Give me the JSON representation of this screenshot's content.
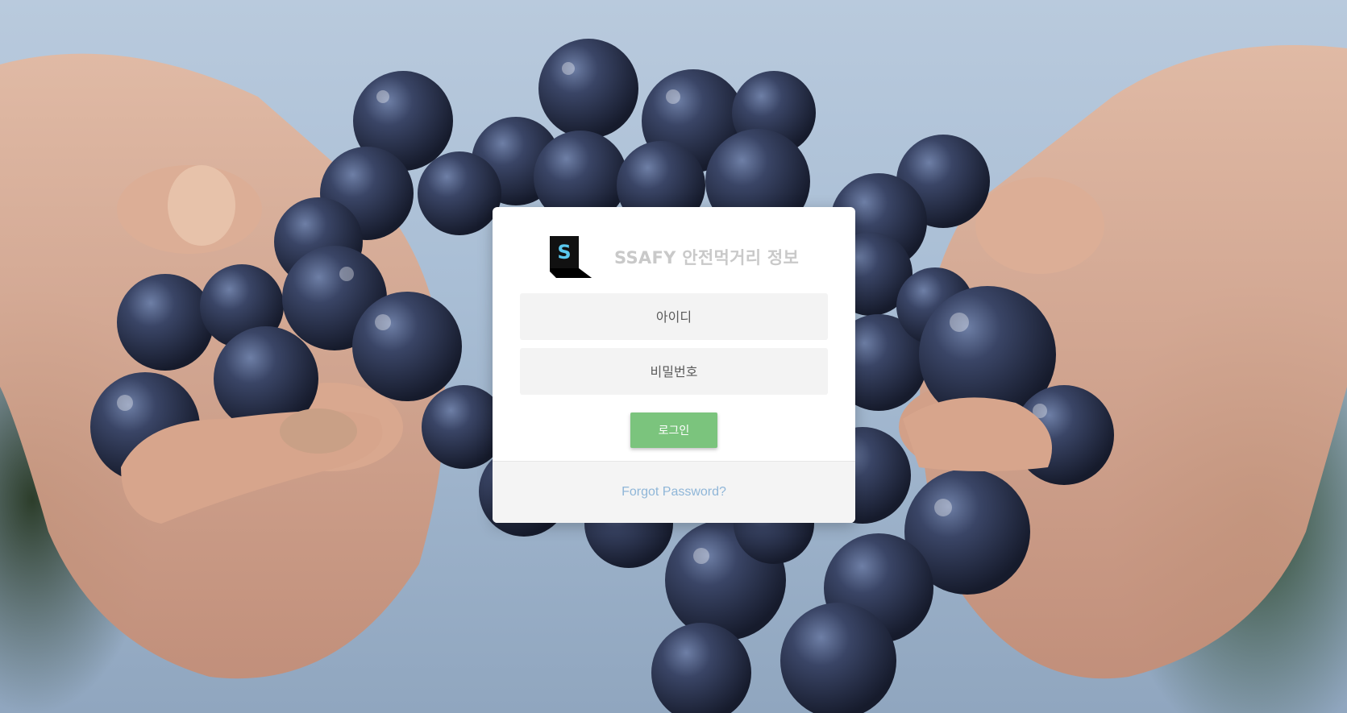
{
  "background": {
    "icon": "grapes-in-hands-photo"
  },
  "login": {
    "logo_icon": "ssafy-logo-icon",
    "title": "SSAFY 안전먹거리 정보",
    "id_placeholder": "아이디",
    "password_placeholder": "비밀번호",
    "login_label": "로그인",
    "forgot_label": "Forgot Password?"
  },
  "colors": {
    "accent_button": "#7bc47d",
    "link": "#8fb6d8",
    "title": "#c9c9c9"
  }
}
